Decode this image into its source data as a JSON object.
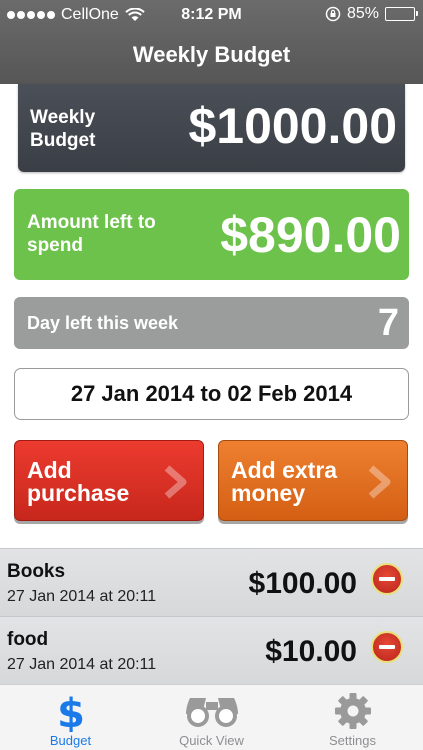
{
  "status": {
    "carrier": "CellOne",
    "time": "8:12 PM",
    "battery": "85%",
    "battery_level": 0.85
  },
  "nav": {
    "title": "Weekly Budget"
  },
  "budget": {
    "label": "Weekly Budget",
    "amount": "$1000.00"
  },
  "left_to_spend": {
    "label": "Amount left to spend",
    "amount": "$890.00"
  },
  "days_left": {
    "label": "Day left this week",
    "value": "7"
  },
  "date_range": "27 Jan 2014 to 02 Feb 2014",
  "actions": {
    "add_purchase": "Add purchase",
    "add_extra": "Add extra money"
  },
  "purchases": [
    {
      "name": "Books",
      "time": "27 Jan 2014 at 20:11",
      "amount": "$100.00"
    },
    {
      "name": "food",
      "time": "27 Jan 2014 at 20:11",
      "amount": "$10.00"
    }
  ],
  "tabs": [
    {
      "label": "Budget",
      "icon": "dollar-icon",
      "active": true
    },
    {
      "label": "Quick View",
      "icon": "binoculars-icon",
      "active": false
    },
    {
      "label": "Settings",
      "icon": "gear-icon",
      "active": false
    }
  ],
  "colors": {
    "budget_card": "#42464e",
    "left_card": "#6cc24a",
    "days_card": "#9b9d9c",
    "purchase_button": "#d9301f",
    "extra_button": "#e26e20",
    "tab_active": "#1a7be8"
  }
}
